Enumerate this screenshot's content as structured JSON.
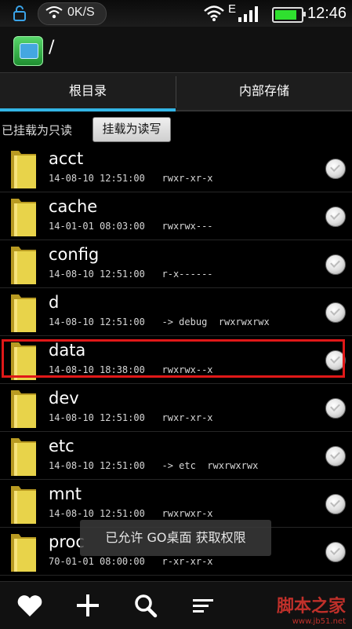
{
  "status_bar": {
    "speed": "0K/S",
    "network_type": "E",
    "time": "12:46",
    "battery_level_percent": 85
  },
  "title_bar": {
    "path": "/"
  },
  "tabs": [
    {
      "label": "根目录",
      "active": true
    },
    {
      "label": "内部存储",
      "active": false
    }
  ],
  "mount": {
    "status_label": "已挂载为只读",
    "button_label": "挂载为读写"
  },
  "files": [
    {
      "name": "acct",
      "meta": "14-08-10 12:51:00   rwxr-xr-x"
    },
    {
      "name": "cache",
      "meta": "14-01-01 08:03:00   rwxrwx---"
    },
    {
      "name": "config",
      "meta": "14-08-10 12:51:00   r-x------"
    },
    {
      "name": "d",
      "meta": "14-08-10 12:51:00   -> debug  rwxrwxrwx"
    },
    {
      "name": "data",
      "meta": "14-08-10 18:38:00   rwxrwx--x"
    },
    {
      "name": "dev",
      "meta": "14-08-10 12:51:00   rwxr-xr-x"
    },
    {
      "name": "etc",
      "meta": "14-08-10 12:51:00   -> etc  rwxrwxrwx"
    },
    {
      "name": "mnt",
      "meta": "14-08-10 12:51:00   rwxrwxr-x"
    },
    {
      "name": "proc",
      "meta": "70-01-01 08:00:00   r-xr-xr-x"
    }
  ],
  "toast": "已允许 GO桌面 获取权限",
  "toolbar": {
    "icons": [
      "heart-icon",
      "plus-icon",
      "search-icon",
      "sort-icon"
    ]
  },
  "watermark": {
    "text": "脚本之家",
    "url": "www.jb51.net"
  },
  "colors": {
    "tab_indicator": "#33b5e5",
    "highlight_box": "#e01818",
    "folder": "#e8d34a"
  }
}
